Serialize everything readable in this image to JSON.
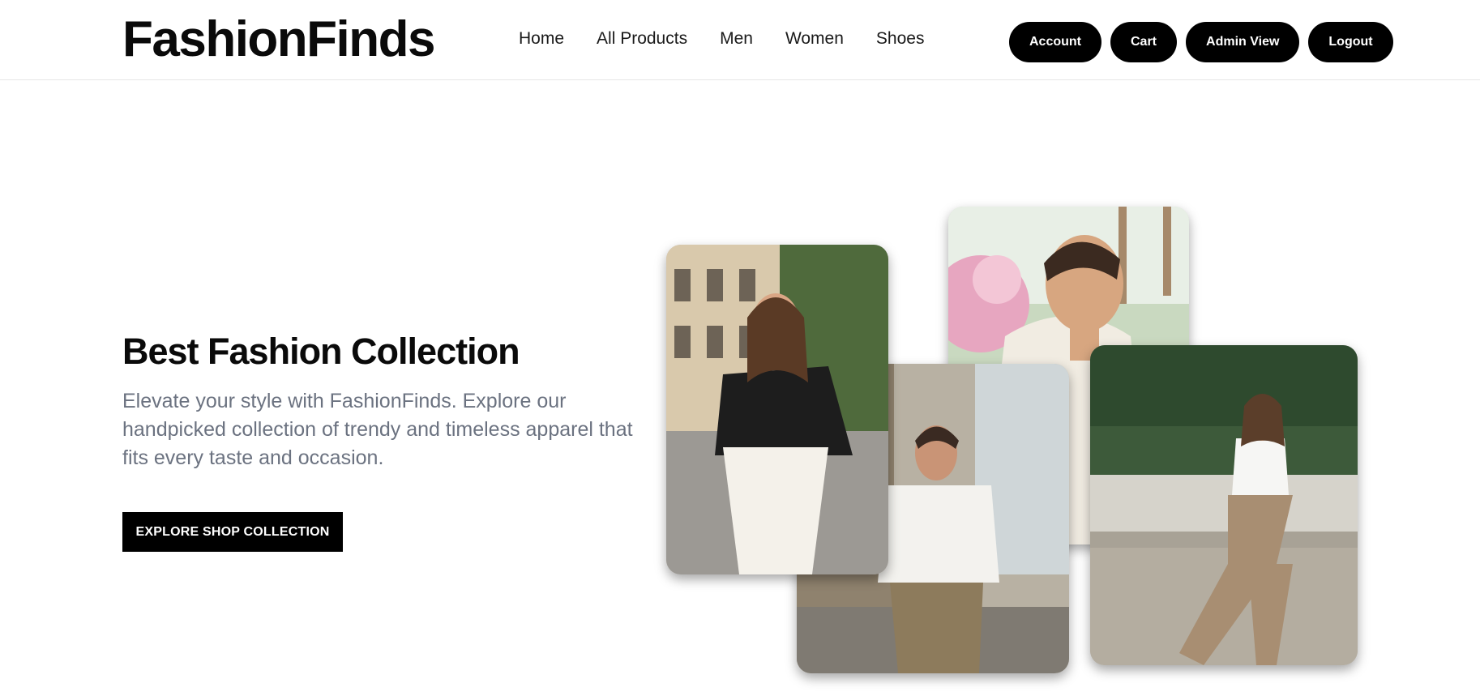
{
  "brand": {
    "name": "FashionFinds"
  },
  "nav": {
    "items": [
      {
        "label": "Home"
      },
      {
        "label": "All Products"
      },
      {
        "label": "Men"
      },
      {
        "label": "Women"
      },
      {
        "label": "Shoes"
      }
    ]
  },
  "actions": {
    "account": "Account",
    "cart": "Cart",
    "admin_view": "Admin View",
    "logout": "Logout"
  },
  "hero": {
    "title": "Best Fashion Collection",
    "description": "Elevate your style with FashionFinds. Explore our handpicked collection of trendy and timeless apparel that fits every taste and occasion.",
    "cta_label": "EXPLORE SHOP COLLECTION"
  },
  "colors": {
    "primary": "#000000",
    "text_muted": "#6b7280",
    "background": "#ffffff"
  }
}
